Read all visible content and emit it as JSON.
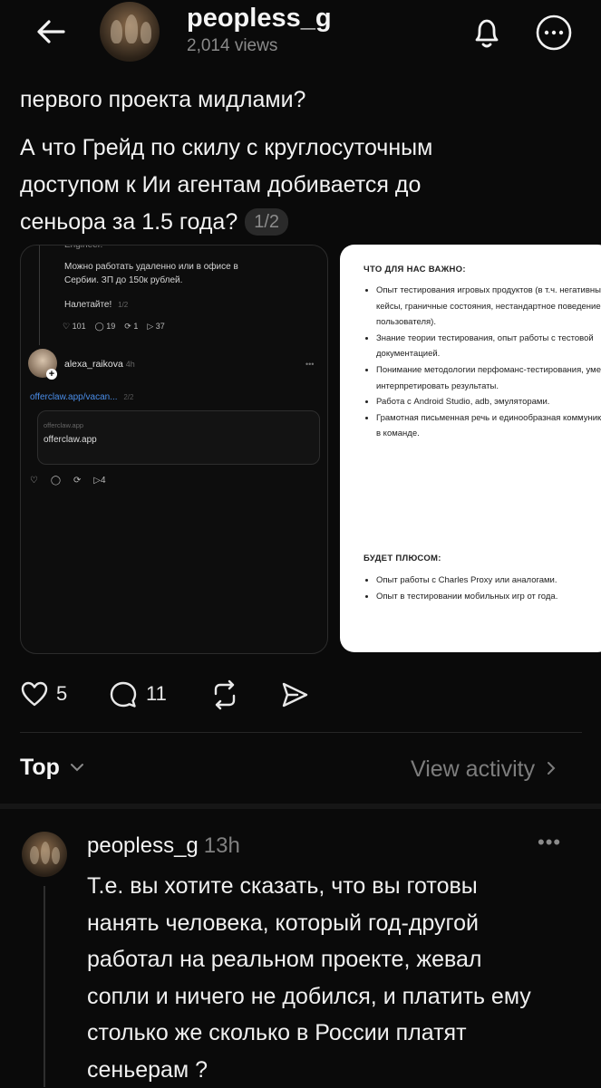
{
  "header": {
    "username": "peopless_g",
    "views": "2,014 views",
    "icons": [
      "back-arrow-icon",
      "bell-icon",
      "more-circle-icon"
    ]
  },
  "post": {
    "text_line0": "первого проекта мидлами?",
    "text_line1": "А что Грейд по скилу с круглосуточным",
    "text_line2": "доступом к Ии агентам добивается до",
    "text_line3": "сеньора за 1.5 года?",
    "pager": "1/2",
    "image1": {
      "clipped_top": "Engineer.",
      "text1": "Можно работать удаленно или в офисе в",
      "text2": "Сербии. ЗП до 150к рублей.",
      "text3": "Налетайте!",
      "mini_pager": "1/2",
      "likes": "101",
      "comments": "19",
      "reposts": "1",
      "shares": "37",
      "reply_user": "alexa_raikova",
      "reply_time": "4h",
      "reply_link": "offerclaw.app/vacan...",
      "reply_pager": "2/2",
      "card_small": "offerclaw.app",
      "card_big": "offerclaw.app",
      "reply_shares": "4"
    },
    "image2": {
      "heading1": "ЧТО ДЛЯ НАС ВАЖНО:",
      "items1": [
        "Опыт тестирования игровых продуктов (в т.ч. негативные кейсы, граничные состояния, нестандартное поведение пользователя).",
        "Знание теории тестирования, опыт работы с тестовой документацией.",
        "Понимание методологии перфоманс-тестирования, умение интерпретировать результаты.",
        "Работа с Android Studio, adb, эмуляторами.",
        "Грамотная письменная речь и единообразная коммуникация в команде."
      ],
      "heading2": "БУДЕТ ПЛЮСОМ:",
      "items2": [
        "Опыт работы с Charles Proxy или аналогами.",
        "Опыт в тестировании мобильных игр от года."
      ]
    },
    "actions": {
      "likes": "5",
      "comments": "11"
    }
  },
  "sort": {
    "label": "Top",
    "view_activity": "View activity"
  },
  "comment": {
    "username": "peopless_g",
    "time": "13h",
    "more": "•••",
    "line1": "Т.е. вы хотите сказать, что вы готовы",
    "line2": "нанять человека, который год-другой",
    "line3": "работал на реальном проекте, жевал",
    "line4": "сопли и ничего не добился, и платить ему",
    "line5": "столько же сколько в России платят",
    "line6": "сеньерам ?"
  }
}
